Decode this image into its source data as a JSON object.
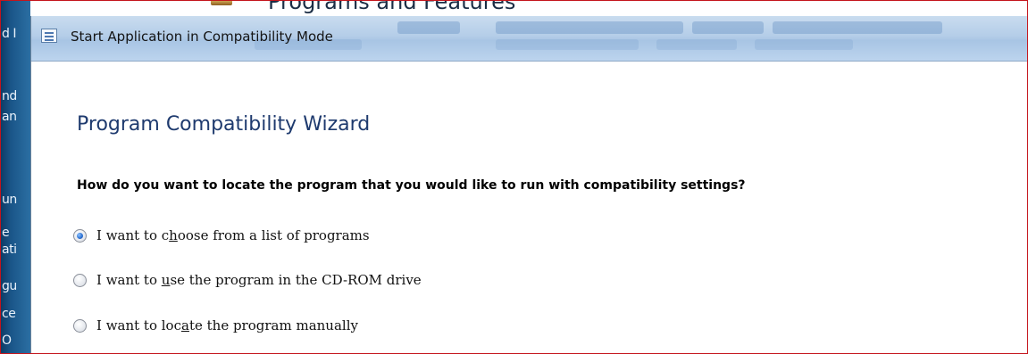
{
  "background": {
    "window_title": "Programs and Features",
    "left_fragments": [
      "d I",
      "nd",
      "an",
      "un",
      "e",
      "ati",
      "gu",
      "ce",
      "O"
    ]
  },
  "dialog": {
    "title": "Start Application in Compatibility Mode",
    "heading": "Program Compatibility Wizard",
    "question": "How do you want to locate the program that you would like to run with compatibility settings?",
    "options": [
      {
        "pre": "I want to c",
        "accel": "h",
        "post": "oose from a list of programs",
        "selected": true
      },
      {
        "pre": "I want to ",
        "accel": "u",
        "post": "se the program in the CD-ROM drive",
        "selected": false
      },
      {
        "pre": "I want to loc",
        "accel": "a",
        "post": "te the program manually",
        "selected": false
      }
    ]
  },
  "colors": {
    "frame_red": "#c4141b",
    "heading_blue": "#1e3a6e",
    "titlebar_blue": "#b4cde8"
  },
  "icons": {
    "title_icon": "window-list-icon",
    "bg_icon": "programs-features-icon"
  }
}
